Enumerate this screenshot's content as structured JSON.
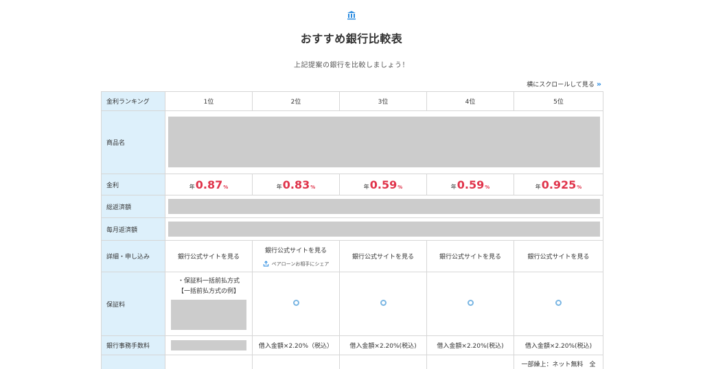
{
  "header": {
    "icon": "bank-icon",
    "title": "おすすめ銀行比較表",
    "subtitle": "上記提案の銀行を比較しましょう！"
  },
  "scroll_hint": {
    "label": "横にスクロールして見る",
    "icon": "double-chevron-right-icon"
  },
  "colors": {
    "accent_red": "#e0344b",
    "rowhead_bg": "#ddf0fb",
    "placeholder_gray": "#cccccc",
    "icon_blue": "#2a8be0"
  },
  "table": {
    "row_labels": {
      "ranking": "金利ランキング",
      "product": "商品名",
      "rate": "金利",
      "total": "総返済額",
      "monthly": "毎月返済額",
      "apply": "詳細・申し込み",
      "guarantee": "保証料",
      "fee": "銀行事務手数料"
    },
    "ranks": [
      "1位",
      "2位",
      "3位",
      "4位",
      "5位"
    ],
    "rates": [
      {
        "prefix": "年",
        "value": "0.87",
        "unit": "%"
      },
      {
        "prefix": "年",
        "value": "0.83",
        "unit": "%"
      },
      {
        "prefix": "年",
        "value": "0.59",
        "unit": "%"
      },
      {
        "prefix": "年",
        "value": "0.59",
        "unit": "%"
      },
      {
        "prefix": "年",
        "value": "0.925",
        "unit": "%"
      }
    ],
    "apply_links": [
      "銀行公式サイトを見る",
      "銀行公式サイトを見る",
      "銀行公式サイトを見る",
      "銀行公式サイトを見る",
      "銀行公式サイトを見る"
    ],
    "share_label": "ペアローンお相手にシェア",
    "guarantee_col1": [
      "・保証料一括前払方式",
      "【一括前払方式の例】"
    ],
    "fees": [
      "",
      "借入金額×2.20%（税込）",
      "借入金額×2.20%(税込)",
      "借入金額×2.20%(税込)",
      "借入金額×2.20%(税込)"
    ],
    "last_row_col5": "一部繰上：ネット無料　全"
  }
}
